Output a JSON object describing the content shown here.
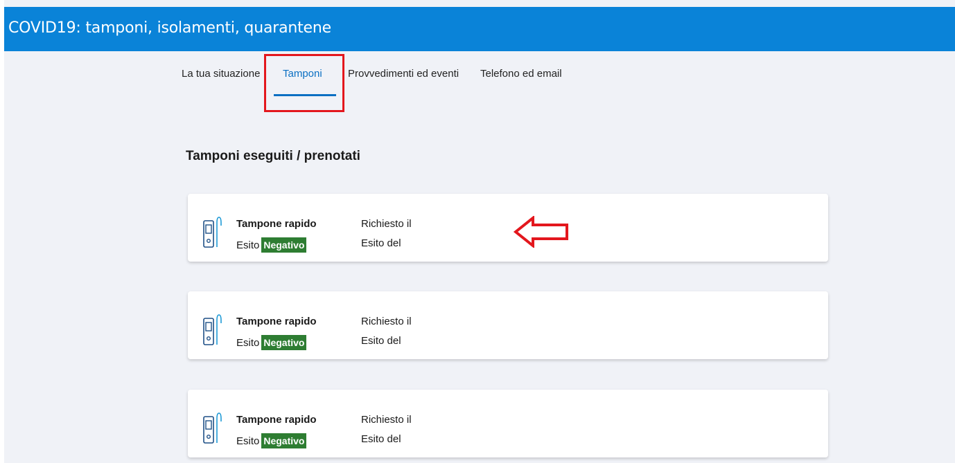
{
  "header": {
    "title": "COVID19: tamponi, isolamenti, quarantene"
  },
  "tabs": [
    {
      "label": "La tua situazione",
      "active": false
    },
    {
      "label": "Tamponi",
      "active": true
    },
    {
      "label": "Provvedimenti ed eventi",
      "active": false
    },
    {
      "label": "Telefono ed email",
      "active": false
    }
  ],
  "section": {
    "title": "Tamponi eseguiti / prenotati"
  },
  "tests": [
    {
      "name": "Tampone rapido",
      "esito_label": "Esito",
      "result": "Negativo",
      "requested_label": "Richiesto il",
      "result_date_label": "Esito del"
    },
    {
      "name": "Tampone rapido",
      "esito_label": "Esito",
      "result": "Negativo",
      "requested_label": "Richiesto il",
      "result_date_label": "Esito del"
    },
    {
      "name": "Tampone rapido",
      "esito_label": "Esito",
      "result": "Negativo",
      "requested_label": "Richiesto il",
      "result_date_label": "Esito del"
    }
  ],
  "colors": {
    "header": "#0a83d8",
    "active_tab": "#0a6fc2",
    "negative_badge": "#2e7d32",
    "annotation": "#e3171d",
    "background": "#f0f2f7"
  },
  "icons": {
    "test_icon": "rapid-test-kit-icon",
    "annotation_arrow": "left-arrow-outline-icon"
  }
}
